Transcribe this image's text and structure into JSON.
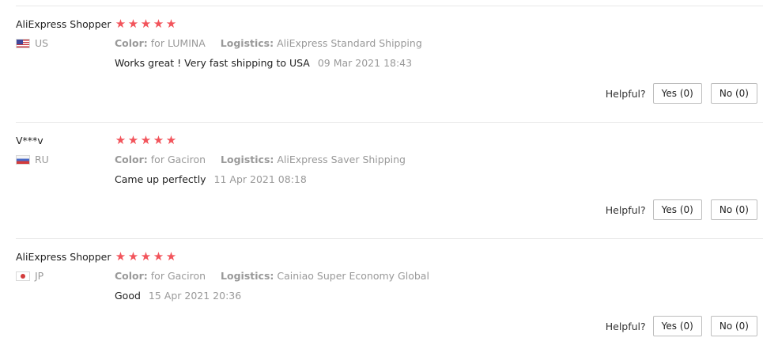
{
  "labels": {
    "color": "Color:",
    "logistics": "Logistics:",
    "helpful": "Helpful?"
  },
  "rating_color": "#f2545b",
  "reviews": [
    {
      "reviewer": "AliExpress Shopper",
      "country": "US",
      "flag_icon": "us-flag-icon",
      "rating": 5,
      "color_value": "for LUMINA",
      "logistics_value": "AliExpress Standard Shipping",
      "feedback": "Works great ! Very fast shipping to USA",
      "date": "09 Mar 2021 18:43",
      "yes_label": "Yes (0)",
      "no_label": "No (0)"
    },
    {
      "reviewer": "V***v",
      "country": "RU",
      "flag_icon": "ru-flag-icon",
      "rating": 5,
      "color_value": "for Gaciron",
      "logistics_value": "AliExpress Saver Shipping",
      "feedback": "Came up perfectly",
      "date": "11 Apr 2021 08:18",
      "yes_label": "Yes (0)",
      "no_label": "No (0)"
    },
    {
      "reviewer": "AliExpress Shopper",
      "country": "JP",
      "flag_icon": "jp-flag-icon",
      "rating": 5,
      "color_value": "for Gaciron",
      "logistics_value": "Cainiao Super Economy Global",
      "feedback": "Good",
      "date": "15 Apr 2021 20:36",
      "yes_label": "Yes (0)",
      "no_label": "No (0)"
    }
  ]
}
